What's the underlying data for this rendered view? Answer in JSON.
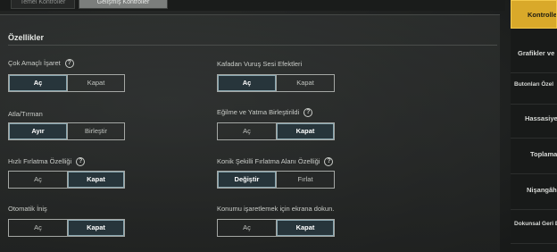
{
  "tabs": [
    {
      "label": "Temel Kontroller"
    },
    {
      "label": "Gelişmiş Kontroller"
    }
  ],
  "section_title": "Özellikler",
  "settings": {
    "multi_marker": {
      "label": "Çok Amaçlı İşaret",
      "opt1": "Aç",
      "opt2": "Kapat",
      "selected": "Aç"
    },
    "hit_sound": {
      "label": "Kafadan Vuruş Sesi Efektleri",
      "opt1": "Aç",
      "opt2": "Kapat",
      "selected": "Aç"
    },
    "jump_climb": {
      "label": "Atla/Tırman",
      "opt1": "Ayır",
      "opt2": "Birleştir",
      "selected": "Ayır"
    },
    "peek_prone": {
      "label": "Eğilme ve Yatma Birleştirildi",
      "opt1": "Aç",
      "opt2": "Kapat",
      "selected": "Kapat"
    },
    "quick_throw": {
      "label": "Hızlı Fırlatma Özelliği",
      "opt1": "Aç",
      "opt2": "Kapat",
      "selected": "Kapat"
    },
    "cone_throw": {
      "label": "Konik Şekilli Fırlatma Alanı Özelliği",
      "opt1": "Değiştir",
      "opt2": "Fırlat",
      "selected": "Değiştir"
    },
    "auto_climb": {
      "label": "Otomatik İniş",
      "opt1": "Aç",
      "opt2": "Kapat",
      "selected": "Kapat"
    },
    "tap_mark": {
      "label": "Konumu işaretlemek için ekrana dokun.",
      "opt1": "Aç",
      "opt2": "Kapat",
      "selected": "Kapat"
    }
  },
  "sidebar": {
    "items": [
      {
        "label": "Kontroller"
      },
      {
        "label": "Grafikler ve"
      },
      {
        "label": "Butonları Özel"
      },
      {
        "label": "Hassasiye"
      },
      {
        "label": "Toplama"
      },
      {
        "label": "Nişangâh"
      },
      {
        "label": "Dokunsal Geri B"
      }
    ]
  },
  "colors": {
    "accent": "#d9a92a",
    "selected_bg": "#27353b"
  }
}
